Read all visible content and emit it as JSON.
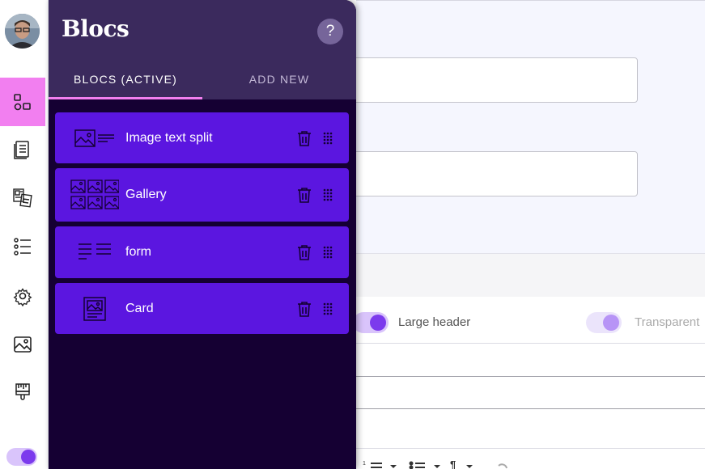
{
  "panel": {
    "title": "Blocs",
    "help_symbol": "?",
    "tabs": [
      {
        "label": "BLOCS (ACTIVE)",
        "active": true
      },
      {
        "label": "ADD NEW",
        "active": false
      }
    ],
    "blocs": [
      {
        "label": "Image text split",
        "icon": "image-text-split-icon"
      },
      {
        "label": "Gallery",
        "icon": "gallery-icon"
      },
      {
        "label": "form",
        "icon": "form-icon"
      },
      {
        "label": "Card",
        "icon": "card-icon"
      }
    ]
  },
  "rail": {
    "items": [
      {
        "icon": "blocks-icon",
        "active": true
      },
      {
        "icon": "document-icon",
        "active": false
      },
      {
        "icon": "pages-icon",
        "active": false
      },
      {
        "icon": "list-icon",
        "active": false
      },
      {
        "icon": "gear-icon",
        "active": false
      },
      {
        "icon": "image-icon",
        "active": false
      },
      {
        "icon": "brush-icon",
        "active": false
      }
    ]
  },
  "background": {
    "toggles": [
      {
        "label": "Large header",
        "on": true
      },
      {
        "label": "Transparent",
        "on": false
      }
    ]
  },
  "colors": {
    "panel_bg": "#150033",
    "panel_header": "#3b2a5d",
    "bloc_bg": "#5b16e0",
    "accent_pink": "#f27ff0",
    "toggle_purple": "#7c3aed"
  }
}
